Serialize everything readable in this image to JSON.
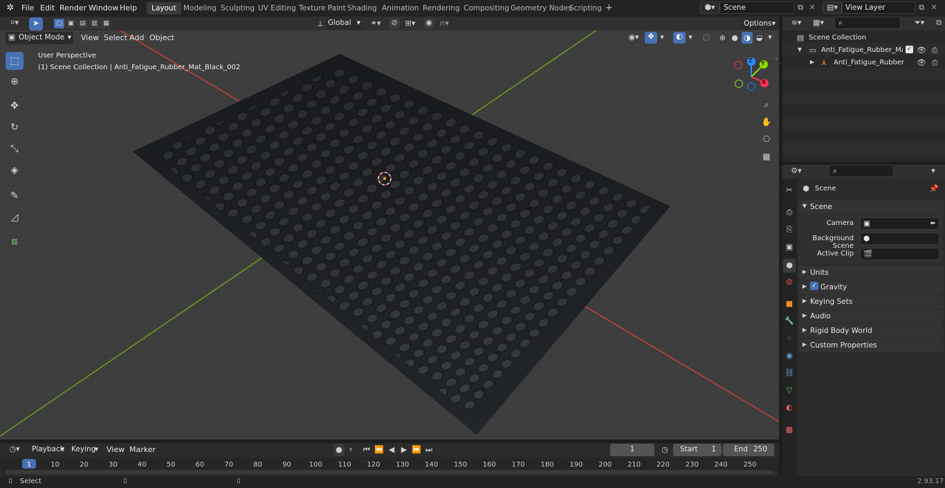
{
  "topbar": {
    "menus": [
      "File",
      "Edit",
      "Render",
      "Window",
      "Help"
    ],
    "workspaces": [
      "Layout",
      "Modeling",
      "Sculpting",
      "UV Editing",
      "Texture Paint",
      "Shading",
      "Animation",
      "Rendering",
      "Compositing",
      "Geometry Nodes",
      "Scripting"
    ],
    "active_workspace": "Layout",
    "scene_name": "Scene",
    "view_layer": "View Layer",
    "add_tab": "+"
  },
  "viewport_header": {
    "mode": "Object Mode",
    "menus": [
      "View",
      "Select",
      "Add",
      "Object"
    ],
    "transform_orientation": "Global",
    "options_label": "Options"
  },
  "viewport": {
    "perspective_label": "User Perspective",
    "collection_label": "(1) Scene Collection | Anti_Fatigue_Rubber_Mat_Black_002",
    "gizmo": {
      "z": "Z",
      "y": "Y",
      "x": "X"
    },
    "colors": {
      "background": "#3d3d3d",
      "grid": "#484848",
      "x_axis": "#c2413b",
      "y_axis": "#6b9a1f",
      "mat": "#22252a",
      "hole": "#2e3134",
      "accent": "#4772b3"
    }
  },
  "outliner": {
    "root": "Scene Collection",
    "items": [
      {
        "label": "Anti_Fatigue_Rubber_Mat_Bla",
        "type": "collection"
      },
      {
        "label": "Anti_Fatigue_Rubber_Ma",
        "type": "object"
      }
    ]
  },
  "properties": {
    "context_label": "Scene",
    "panel_title": "Scene",
    "fields": [
      {
        "label": "Camera",
        "value": ""
      },
      {
        "label": "Background Scene",
        "value": ""
      },
      {
        "label": "Active Clip",
        "value": ""
      }
    ],
    "subpanels": [
      "Units",
      "Gravity",
      "Keying Sets",
      "Audio",
      "Rigid Body World",
      "Custom Properties"
    ],
    "gravity_checked": true
  },
  "timeline": {
    "menus": [
      "Playback",
      "Keying",
      "View",
      "Marker"
    ],
    "current_frame": "1",
    "start_label": "Start",
    "start_value": "1",
    "end_label": "End",
    "end_value": "250",
    "ticks": [
      "1",
      "10",
      "20",
      "30",
      "40",
      "50",
      "60",
      "70",
      "80",
      "90",
      "100",
      "110",
      "120",
      "130",
      "140",
      "150",
      "160",
      "170",
      "180",
      "190",
      "200",
      "210",
      "220",
      "230",
      "240",
      "250"
    ]
  },
  "statusbar": {
    "left_label": "Select",
    "version": "2.93.17"
  }
}
